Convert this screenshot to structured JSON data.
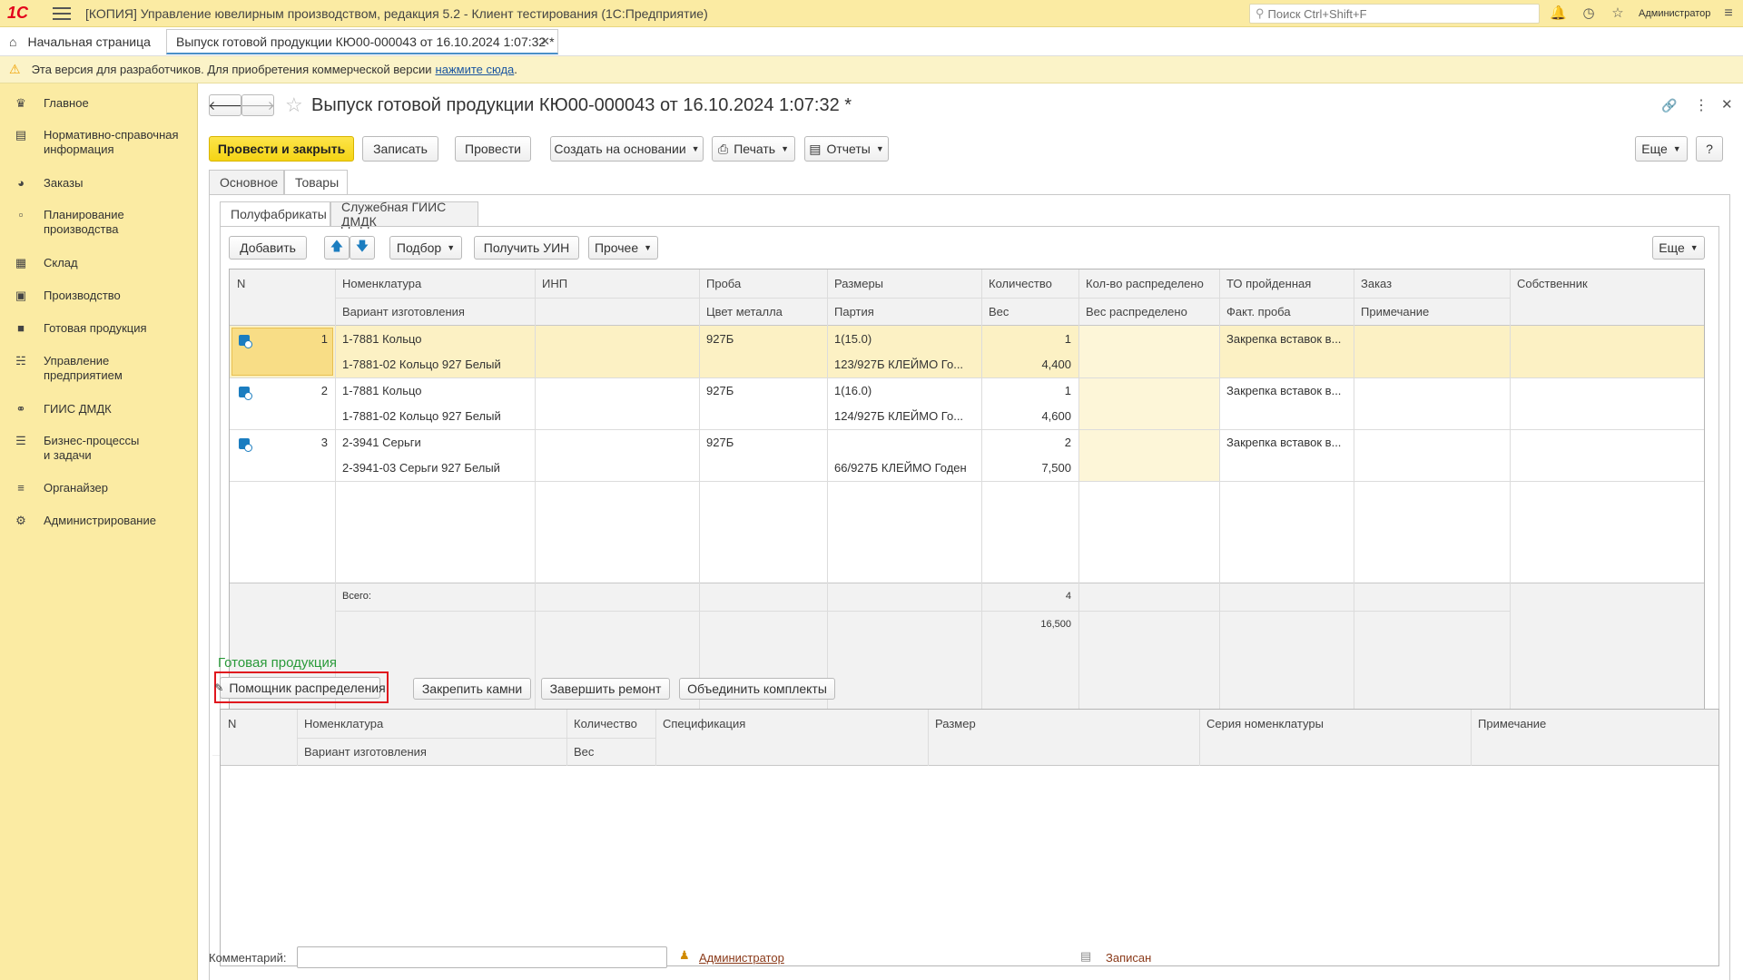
{
  "app": {
    "logo": "1С",
    "title": "[КОПИЯ] Управление ювелирным производством, редакция 5.2  - Клиент тестирования (1С:Предприятие)",
    "search_placeholder": "Поиск Ctrl+Shift+F",
    "user": "Администратор"
  },
  "tabs": {
    "home": "Начальная страница",
    "doc": "Выпуск готовой продукции КЮ00-000043 от 16.10.2024 1:07:32 *"
  },
  "warning": {
    "text": "Эта версия для разработчиков. Для приобретения коммерческой версии",
    "link": "нажмите сюда",
    "tail": "."
  },
  "sidebar": {
    "items": [
      {
        "label": "Главное",
        "icon": "crown-icon"
      },
      {
        "label": "Нормативно-справочная\nинформация",
        "icon": "book-icon"
      },
      {
        "label": "Заказы",
        "icon": "pie-icon"
      },
      {
        "label": "Планирование\nпроизводства",
        "icon": "clipboard-icon"
      },
      {
        "label": "Склад",
        "icon": "warehouse-icon"
      },
      {
        "label": "Производство",
        "icon": "factory-icon"
      },
      {
        "label": "Готовая продукция",
        "icon": "box-icon"
      },
      {
        "label": "Управление\nпредприятием",
        "icon": "org-icon"
      },
      {
        "label": "ГИИС ДМДК",
        "icon": "ring-icon"
      },
      {
        "label": "Бизнес-процессы\nи задачи",
        "icon": "tasks-icon"
      },
      {
        "label": "Органайзер",
        "icon": "organizer-icon"
      },
      {
        "label": "Администрирование",
        "icon": "gear-icon"
      }
    ]
  },
  "form": {
    "title": "Выпуск готовой продукции КЮ00-000043 от 16.10.2024 1:07:32 *",
    "toolbar": {
      "post_close": "Провести и закрыть",
      "save": "Записать",
      "post": "Провести",
      "create_based": "Создать на основании",
      "print": "Печать",
      "reports": "Отчеты",
      "more": "Еще",
      "help": "?"
    },
    "tabs": [
      "Основное",
      "Товары"
    ],
    "subtabs": [
      "Полуфабрикаты",
      "Служебная ГИИС ДМДК"
    ],
    "grid_toolbar": {
      "add": "Добавить",
      "pick": "Подбор",
      "get_uin": "Получить УИН",
      "other": "Прочее",
      "more": "Еще"
    },
    "grid1": {
      "headers_top": [
        "N",
        "Номенклатура",
        "ИНП",
        "Проба",
        "Размеры",
        "Количество",
        "Кол-во распределено",
        "ТО пройденная",
        "Заказ",
        "Собственник"
      ],
      "headers_bottom": [
        "Вариант изготовления",
        "Цвет металла",
        "Партия",
        "Вес",
        "Вес распределено",
        "Факт. проба",
        "Примечание"
      ],
      "rows": [
        {
          "n": "1",
          "nom": "1-7881 Кольцо",
          "variant": "1-7881-02 Кольцо 927 Белый",
          "proba": "927Б",
          "size": "1(15.0)",
          "party": "123/927Б КЛЕЙМО Го...",
          "qty": "1",
          "weight": "4,400",
          "to": "Закрепка вставок в..."
        },
        {
          "n": "2",
          "nom": "1-7881 Кольцо",
          "variant": "1-7881-02 Кольцо 927 Белый",
          "proba": "927Б",
          "size": "1(16.0)",
          "party": "124/927Б КЛЕЙМО Го...",
          "qty": "1",
          "weight": "4,600",
          "to": "Закрепка вставок в..."
        },
        {
          "n": "3",
          "nom": "2-3941 Серьги",
          "variant": "2-3941-03 Серьги 927 Белый",
          "proba": "927Б",
          "size": "",
          "party": "66/927Б КЛЕЙМО Годен",
          "qty": "2",
          "weight": "7,500",
          "to": "Закрепка вставок в..."
        }
      ],
      "footer": {
        "label": "Всего:",
        "qty": "4",
        "weight": "16,500"
      }
    },
    "finished": {
      "section_title": "Готовая продукция",
      "buttons": {
        "helper": "Помощник распределения",
        "fix_stones": "Закрепить камни",
        "finish_repair": "Завершить ремонт",
        "merge_sets": "Объединить комплекты"
      },
      "headers_top": [
        "N",
        "Номенклатура",
        "Количество",
        "Спецификация",
        "Размер",
        "Серия номенклатуры",
        "Примечание"
      ],
      "headers_bottom": [
        "Вариант изготовления",
        "Вес"
      ]
    },
    "footer": {
      "comment_label": "Комментарий:",
      "comment_value": "",
      "author": "Администратор",
      "status": "Записан"
    }
  },
  "colors": {
    "accent_yellow": "#fbeba3",
    "selected_row": "#fcf1c4",
    "green_title": "#2a9a3a",
    "highlight_red": "#e0161e"
  }
}
